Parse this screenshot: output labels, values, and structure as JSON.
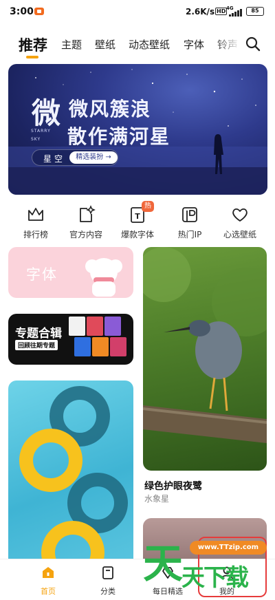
{
  "status_bar": {
    "time": "3:00",
    "net_speed": "2.6K/s",
    "hd_label": "HD",
    "network": "4G",
    "battery": "85"
  },
  "tabs": [
    "推荐",
    "主题",
    "壁纸",
    "动态壁纸",
    "字体",
    "铃声"
  ],
  "banner": {
    "title_big": "微",
    "title_line1": "微风簇浪",
    "title_line2": "散作满河星",
    "en_text": "STARRY SKY",
    "tag": "星空",
    "button": "精选装扮 →"
  },
  "quick_links": [
    {
      "label": "排行榜",
      "icon": "crown-icon"
    },
    {
      "label": "官方内容",
      "icon": "sparkle-document-icon"
    },
    {
      "label": "爆款字体",
      "icon": "font-T-icon",
      "badge": "热"
    },
    {
      "label": "热门IP",
      "icon": "ip-icon"
    },
    {
      "label": "心选壁纸",
      "icon": "heart-icon"
    }
  ],
  "cards": {
    "font_card": "字体",
    "theme_card_title": "专题合辑",
    "theme_card_sub": "回顾往期专题",
    "bird_title": "绿色护眼夜鹭",
    "bird_author": "水象星"
  },
  "bottom_nav": [
    "首页",
    "分类",
    "每日精选",
    "我的"
  ],
  "watermark": {
    "url": "www.TTzip.com",
    "big": "天",
    "rest": "天下载"
  },
  "colors": {
    "accent": "#f5a30f",
    "hot_badge": "#f0673b",
    "font_card_bg": "#fbd3db"
  }
}
